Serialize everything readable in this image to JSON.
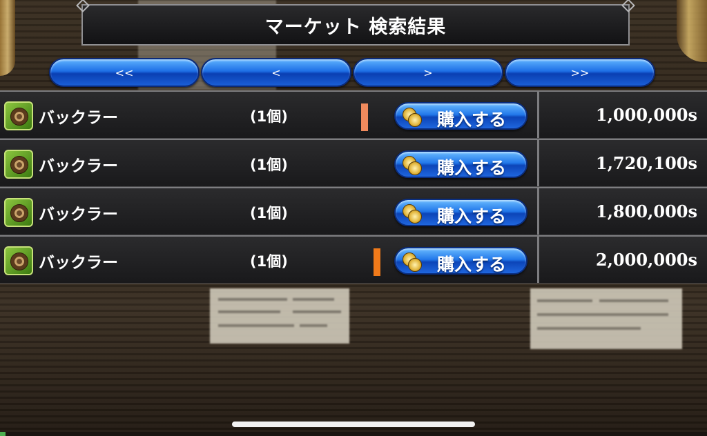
{
  "title": "マーケット 検索結果",
  "pager": {
    "first": "<<",
    "prev": "<",
    "next": ">",
    "last": ">>"
  },
  "buy_label": "購入する",
  "rows": [
    {
      "name": "バックラー",
      "qty": "(1個)",
      "price": "1,000,000s",
      "marker_color": "#f08a5d"
    },
    {
      "name": "バックラー",
      "qty": "(1個)",
      "price": "1,720,100s",
      "marker_color": ""
    },
    {
      "name": "バックラー",
      "qty": "(1個)",
      "price": "1,800,000s",
      "marker_color": ""
    },
    {
      "name": "バックラー",
      "qty": "(1個)",
      "price": "2,000,000s",
      "marker_color": "#f07a1a"
    }
  ],
  "colors": {
    "button_blue": "#1e6fe6",
    "item_icon_green": "#8cc63f",
    "panel_dark": "#1a1a1c"
  },
  "icons": {
    "item": "buckler-shield-icon",
    "buy": "coins-icon"
  }
}
